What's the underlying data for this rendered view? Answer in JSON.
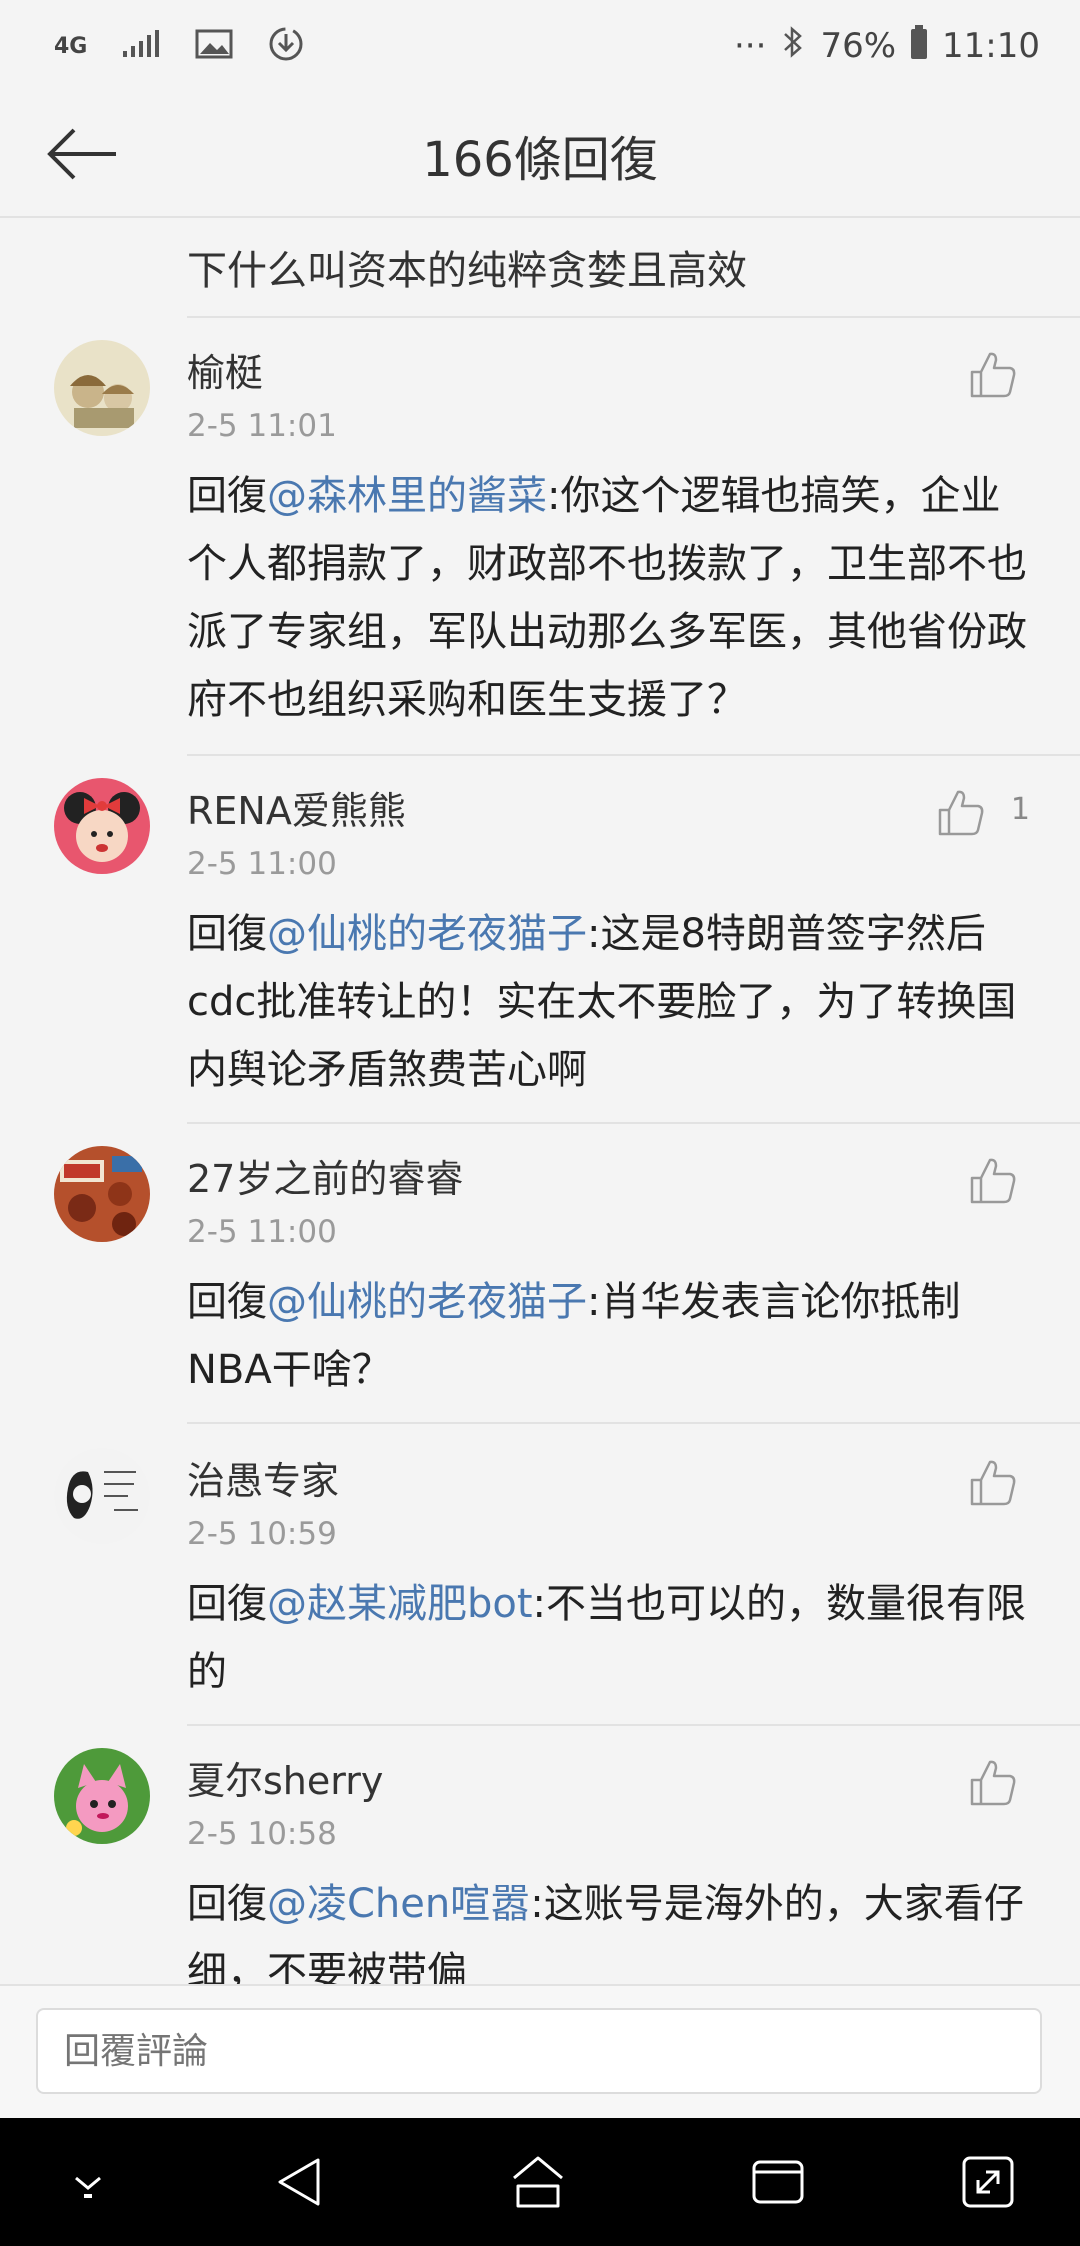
{
  "status_bar": {
    "network": "4G",
    "more": "···",
    "battery": "76%",
    "time": "11:10"
  },
  "header": {
    "title": "166條回復"
  },
  "previous_tail": "下什么叫资本的纯粹贪婪且高效",
  "comments": [
    {
      "name": "榆梃",
      "time": "2-5 11:01",
      "prefix": "回復",
      "mention": "@森林里的酱菜",
      "body": ":你这个逻辑也搞笑，企业个人都捐款了，财政部不也拨款了，卫生部不也派了专家组，军队出动那么多军医，其他省份政府不也组织采购和医生支援了？",
      "likes": ""
    },
    {
      "name": "RENA爱熊熊",
      "time": "2-5 11:00",
      "prefix": "回復",
      "mention": "@仙桃的老夜猫子",
      "body": ":这是8特朗普签字然后cdc批准转让的！实在太不要脸了，为了转换国内舆论矛盾煞费苦心啊",
      "likes": "1"
    },
    {
      "name": "27岁之前的睿睿",
      "time": "2-5 11:00",
      "prefix": "回復",
      "mention": "@仙桃的老夜猫子",
      "body": ":肖华发表言论你抵制NBA干啥？",
      "likes": ""
    },
    {
      "name": "治愚专家",
      "time": "2-5 10:59",
      "prefix": "回復",
      "mention": "@赵某减肥bot",
      "body": ":不当也可以的，数量很有限的",
      "likes": ""
    },
    {
      "name": "夏尔sherry",
      "time": "2-5 10:58",
      "prefix": "回復",
      "mention": "@凌Chen喧嚣",
      "body": ":这账号是海外的，大家看仔细，不要被带偏",
      "likes": ""
    }
  ],
  "input": {
    "placeholder": "回覆評論"
  },
  "colors": {
    "mention": "#4a78b0",
    "background": "#f4f4f4",
    "divider": "#e2e2e2"
  }
}
